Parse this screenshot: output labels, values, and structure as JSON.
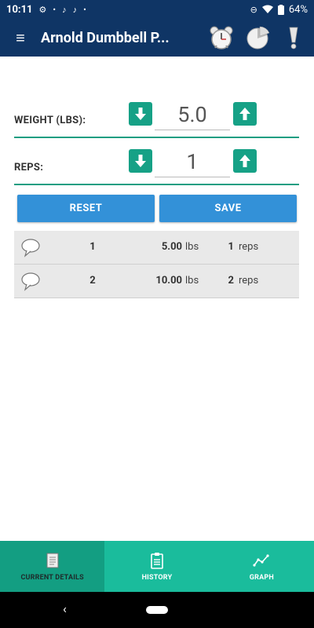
{
  "status_bar": {
    "time": "10:11",
    "battery": "64%"
  },
  "app_bar": {
    "menu_icon": "hamburger-icon",
    "title": "Arnold Dumbbell P...",
    "icons": [
      "alarm-clock-icon",
      "pie-chart-icon",
      "exclamation-icon"
    ]
  },
  "weight": {
    "label": "WEIGHT (LBS):",
    "value": "5.0"
  },
  "reps": {
    "label": "REPS:",
    "value": "1"
  },
  "actions": {
    "reset_label": "RESET",
    "save_label": "SAVE"
  },
  "history": {
    "rows": [
      {
        "set": "1",
        "weight": "5.00",
        "weight_unit": "lbs",
        "reps": "1",
        "reps_unit": "reps"
      },
      {
        "set": "2",
        "weight": "10.00",
        "weight_unit": "lbs",
        "reps": "2",
        "reps_unit": "reps"
      }
    ]
  },
  "bottom_nav": {
    "items": [
      {
        "label": "CURRENT DETAILS",
        "icon": "notepad-icon",
        "active": true
      },
      {
        "label": "HISTORY",
        "icon": "clipboard-icon",
        "active": false
      },
      {
        "label": "GRAPH",
        "icon": "line-graph-icon",
        "active": false
      }
    ]
  },
  "colors": {
    "header": "#0f3565",
    "accent": "#1abc9c",
    "stepper": "#16a186",
    "button": "#3391d8"
  }
}
